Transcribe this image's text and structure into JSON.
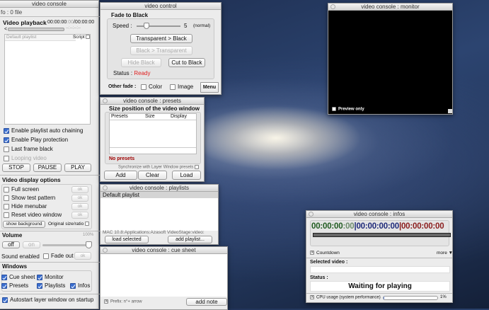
{
  "main": {
    "title": "video console",
    "info": "fo : 0 file",
    "playback_label": "Video playback",
    "time_current": "00:00:00",
    "time_frames": ":00",
    "time_total": "/00:00:00",
    "time_remaining": "--:--:--:--",
    "slider_back": "<",
    "playlist_header": "Default playlist",
    "script_label": "Script",
    "options": [
      {
        "label": "Enable playlist auto chaining",
        "checked": true
      },
      {
        "label": "Enable Play protection",
        "checked": true
      },
      {
        "label": "Last frame black",
        "checked": false
      },
      {
        "label": "Looping video",
        "checked": false,
        "disabled": true
      }
    ],
    "stop": "STOP",
    "pause": "PAUSE",
    "play": "PLAY",
    "display_title": "Video display options",
    "display_items": [
      "Full screen",
      "Show test pattern",
      "Hide menubar",
      "Reset video window"
    ],
    "ok": "ok",
    "show_background": "show background",
    "original_size": "Original size/ratio",
    "volume_title": "Volume",
    "volume_value": "100%",
    "volume_fraction": 1.0,
    "off": "off",
    "on": "on",
    "sound_enabled": "Sound enabled",
    "fade_out": "Fade out",
    "windows_title": "Windows",
    "windows": [
      {
        "label": "Cue sheet",
        "checked": true
      },
      {
        "label": "Monitor",
        "checked": true
      },
      {
        "label": "Presets",
        "checked": true
      },
      {
        "label": "Playlists",
        "checked": true
      },
      {
        "label": "Infos",
        "checked": true
      }
    ],
    "autostart": "Autostart layer window on startup"
  },
  "control": {
    "title": "video control",
    "group": "Fade to Black",
    "speed_label": "Speed :",
    "speed_value": "5",
    "speed_note": "(normal)",
    "t_to_b": "Transparent > Black",
    "b_to_t": "Black > Transparent",
    "hide_black": "Hide Black",
    "cut_black": "Cut to Black",
    "status_label": "Status :",
    "status_value": "Ready",
    "other_fade": "Other fade :",
    "color": "Color",
    "image": "Image",
    "menu": "Menu",
    "status_color": "#e02020"
  },
  "presets": {
    "title": "video console : presets",
    "heading": "Size position of the video window",
    "cols": [
      "Presets",
      "Size",
      "Display"
    ],
    "empty": "No presets",
    "sync": "Synchronize with Layer Window presets",
    "add": "Add",
    "clear": "Clear",
    "load": "Load"
  },
  "playlists": {
    "title": "video console : playlists",
    "items": [
      "Default playlist"
    ],
    "path": "MAC 10.8:Applications:Azasoft VideoStage:video:",
    "load_selected": "load selected",
    "add_playlist": "add playlist..."
  },
  "cue": {
    "title": "video console : cue sheet",
    "prefix": "Prefix: n°+ arrow",
    "add_note": "add note"
  },
  "monitor": {
    "title": "video console : monitor",
    "preview_only": "Preview only"
  },
  "infos": {
    "title": "video console : infos",
    "tc1": "00:00:00",
    "tc1f": ":00",
    "tc2": "|00:00:00:00",
    "tc3": "|00:00:00:00",
    "countdown": "Countdown",
    "more": "more ▼",
    "selected_label": "Selected video :",
    "status_label": "Status :",
    "status_value": "Waiting for playing",
    "cpu_label": "CPU usage (system performance)",
    "cpu_value": "1%",
    "cpu_fraction": 0.01
  }
}
